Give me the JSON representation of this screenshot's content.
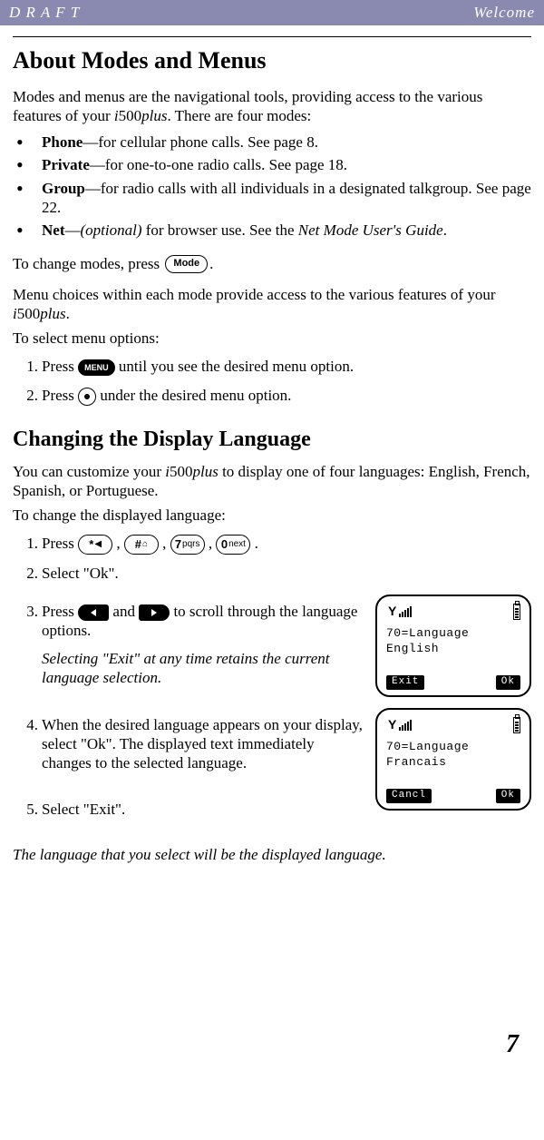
{
  "header": {
    "draft": "D R A F T",
    "welcome": "Welcome"
  },
  "h1": "About Modes and Menus",
  "intro1a": "Modes and menus are the navigational tools, providing access to the various features of your ",
  "intro1b": "i",
  "intro1c": "500",
  "intro1d": "plus",
  "intro1e": ". There are four modes:",
  "bullets": [
    {
      "name": "Phone",
      "dash": "—for cellular phone calls. See page 8."
    },
    {
      "name": "Private",
      "dash": "—for one-to-one radio calls. See page 18."
    },
    {
      "name": "Group",
      "dash": "—for radio calls with all individuals in a designated talkgroup. See page 22."
    }
  ],
  "netline": {
    "name": "Net",
    "dash1": "—",
    "opt": "(optional)",
    "dash2": " for browser use. See the ",
    "guide": "Net Mode User's Guide",
    "end": "."
  },
  "change_modes_a": "To change modes, press ",
  "mode_btn": "Mode",
  "change_modes_b": ".",
  "menu_choices_a": "Menu choices within each mode provide access to the various features of your ",
  "menu_choices_b": "i",
  "menu_choices_c": "500",
  "menu_choices_d": "plus",
  "menu_choices_e": ".",
  "to_select": "To select menu options:",
  "steps1": [
    {
      "n": "1.",
      "a": "Press ",
      "btn": "MENU",
      "b": " until you see the desired menu option."
    },
    {
      "n": "2.",
      "a": "Press ",
      "b": "  under the desired menu option."
    }
  ],
  "h2": "Changing the Display Language",
  "lang_intro_a": "You can customize your ",
  "lang_intro_b": "i",
  "lang_intro_c": "500",
  "lang_intro_d": "plus",
  "lang_intro_e": " to display one of four languages: English, French, Spanish, or Portuguese.",
  "to_change": "To change the displayed language:",
  "keys": {
    "star": "*",
    "starSub": "◀",
    "hash": "#",
    "hashSub": "⌂",
    "seven": "7",
    "sevenSub": "pqrs",
    "zero": "0",
    "zeroSub": "next"
  },
  "steps2": {
    "s1": {
      "n": "1.",
      "a": "Press  ",
      "b": " ,  ",
      "c": " ,  ",
      "d": " ,  ",
      "e": " ."
    },
    "s2": {
      "n": "2.",
      "a": "Select \"Ok\"."
    },
    "s3": {
      "n": "3.",
      "a": "Press ",
      "b": " and ",
      "c": " to scroll through the language options."
    },
    "s3note": "Selecting \"Exit\" at any time retains the current language selection.",
    "s4": {
      "n": "4.",
      "a": "When the desired language appears on your display, select \"Ok\". The displayed text immediately changes to the selected language."
    },
    "s5": {
      "n": "5.",
      "a": "Select \"Exit\"."
    }
  },
  "screen1": {
    "l1": "70=Language",
    "l2": "English",
    "skL": "Exit",
    "skR": "Ok"
  },
  "screen2": {
    "l1": "70=Language",
    "l2": "Francais",
    "skL": "Cancl",
    "skR": "Ok"
  },
  "outro": "The language that you select will be the displayed language.",
  "page": "7"
}
